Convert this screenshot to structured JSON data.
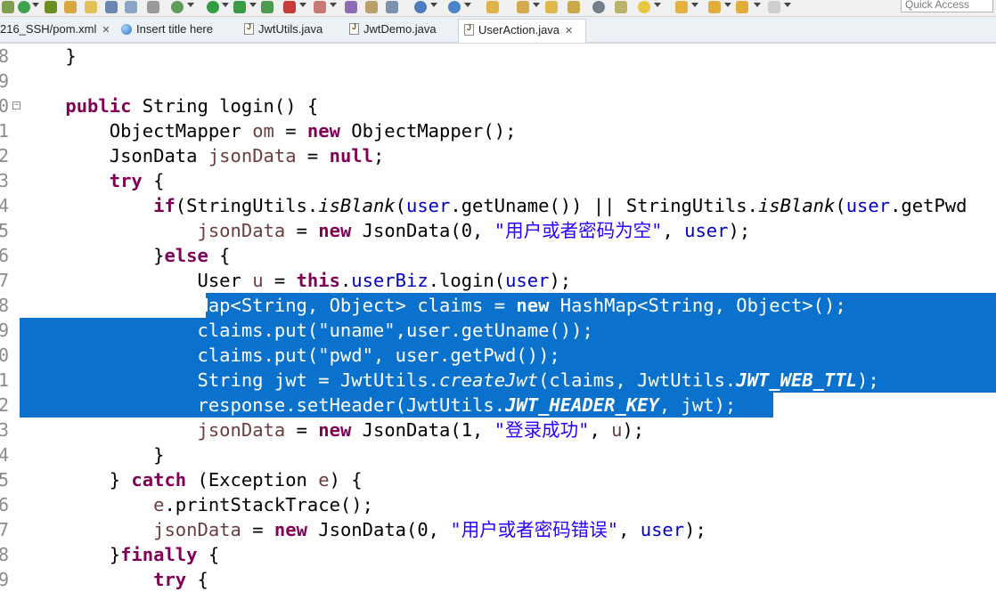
{
  "toolbar": {
    "quick_access_placeholder": "Quick Access"
  },
  "tabs": [
    {
      "label": "216_SSH/pom.xml",
      "icon": "xml-file-icon"
    },
    {
      "label": "Insert title here",
      "icon": "web-page-icon"
    },
    {
      "label": "JwtUtils.java",
      "icon": "java-file-icon"
    },
    {
      "label": "JwtDemo.java",
      "icon": "java-file-icon"
    },
    {
      "label": "UserAction.java",
      "icon": "java-file-icon",
      "active": true
    }
  ],
  "editor": {
    "line_numbers": [
      "8",
      "9",
      "0",
      "1",
      "2",
      "3",
      "4",
      "5",
      "6",
      "7",
      "8",
      "9",
      "0",
      "1",
      "2",
      "3",
      "4",
      "5",
      "6",
      "7",
      "8",
      "9"
    ],
    "lines": [
      [
        [
          "p",
          "    }"
        ]
      ],
      [],
      [
        [
          "p",
          "    "
        ],
        [
          "k",
          "public"
        ],
        [
          "p",
          " String login() {"
        ]
      ],
      [
        [
          "p",
          "        ObjectMapper "
        ],
        [
          "v",
          "om"
        ],
        [
          "p",
          " = "
        ],
        [
          "k",
          "new"
        ],
        [
          "p",
          " ObjectMapper();"
        ]
      ],
      [
        [
          "p",
          "        JsonData "
        ],
        [
          "v",
          "jsonData"
        ],
        [
          "p",
          " = "
        ],
        [
          "k",
          "null"
        ],
        [
          "p",
          ";"
        ]
      ],
      [
        [
          "p",
          "        "
        ],
        [
          "k",
          "try"
        ],
        [
          "p",
          " {"
        ]
      ],
      [
        [
          "p",
          "            "
        ],
        [
          "k",
          "if"
        ],
        [
          "p",
          "(StringUtils."
        ],
        [
          "i",
          "isBlank"
        ],
        [
          "p",
          "("
        ],
        [
          "f",
          "user"
        ],
        [
          "p",
          ".getUname()) || StringUtils."
        ],
        [
          "i",
          "isBlank"
        ],
        [
          "p",
          "("
        ],
        [
          "f",
          "user"
        ],
        [
          "p",
          ".getPwd"
        ]
      ],
      [
        [
          "p",
          "                "
        ],
        [
          "v",
          "jsonData"
        ],
        [
          "p",
          " = "
        ],
        [
          "k",
          "new"
        ],
        [
          "p",
          " JsonData(0, "
        ],
        [
          "s",
          "\"用户或者密码为空\""
        ],
        [
          "p",
          ", "
        ],
        [
          "f",
          "user"
        ],
        [
          "p",
          ");"
        ]
      ],
      [
        [
          "p",
          "            }"
        ],
        [
          "k",
          "else"
        ],
        [
          "p",
          " {"
        ]
      ],
      [
        [
          "p",
          "                User "
        ],
        [
          "v",
          "u"
        ],
        [
          "p",
          " = "
        ],
        [
          "k",
          "this"
        ],
        [
          "p",
          "."
        ],
        [
          "f",
          "userBiz"
        ],
        [
          "p",
          ".login("
        ],
        [
          "f",
          "user"
        ],
        [
          "p",
          ");"
        ]
      ],
      [
        [
          "p",
          "                Map<String, Object> claims = "
        ],
        [
          "k",
          "new"
        ],
        [
          "p",
          " HashMap<String, Object>();"
        ]
      ],
      [
        [
          "p",
          "                claims.put(\"uname\",user.getUname());"
        ]
      ],
      [
        [
          "p",
          "                claims.put(\"pwd\", user.getPwd());"
        ]
      ],
      [
        [
          "p",
          "                String jwt = JwtUtils."
        ],
        [
          "i",
          "createJwt"
        ],
        [
          "p",
          "(claims, JwtUtils."
        ],
        [
          "c",
          "JWT_WEB_TTL"
        ],
        [
          "p",
          ");"
        ]
      ],
      [
        [
          "p",
          "                response.setHeader(JwtUtils."
        ],
        [
          "c",
          "JWT_HEADER_KEY"
        ],
        [
          "p",
          ", jwt);"
        ]
      ],
      [
        [
          "p",
          "                "
        ],
        [
          "v",
          "jsonData"
        ],
        [
          "p",
          " = "
        ],
        [
          "k",
          "new"
        ],
        [
          "p",
          " JsonData(1, "
        ],
        [
          "s",
          "\"登录成功\""
        ],
        [
          "p",
          ", "
        ],
        [
          "v",
          "u"
        ],
        [
          "p",
          ");"
        ]
      ],
      [
        [
          "p",
          "            }"
        ]
      ],
      [
        [
          "p",
          "        } "
        ],
        [
          "k",
          "catch"
        ],
        [
          "p",
          " (Exception "
        ],
        [
          "v",
          "e"
        ],
        [
          "p",
          ") {"
        ]
      ],
      [
        [
          "p",
          "            "
        ],
        [
          "v",
          "e"
        ],
        [
          "p",
          ".printStackTrace();"
        ]
      ],
      [
        [
          "p",
          "            "
        ],
        [
          "v",
          "jsonData"
        ],
        [
          "p",
          " = "
        ],
        [
          "k",
          "new"
        ],
        [
          "p",
          " JsonData(0, "
        ],
        [
          "s",
          "\"用户或者密码错误\""
        ],
        [
          "p",
          ", "
        ],
        [
          "f",
          "user"
        ],
        [
          "p",
          ");"
        ]
      ],
      [
        [
          "p",
          "        }"
        ],
        [
          "k",
          "finally"
        ],
        [
          "p",
          " {"
        ]
      ],
      [
        [
          "p",
          "            "
        ],
        [
          "k",
          "try"
        ],
        [
          "p",
          " {"
        ]
      ]
    ]
  }
}
